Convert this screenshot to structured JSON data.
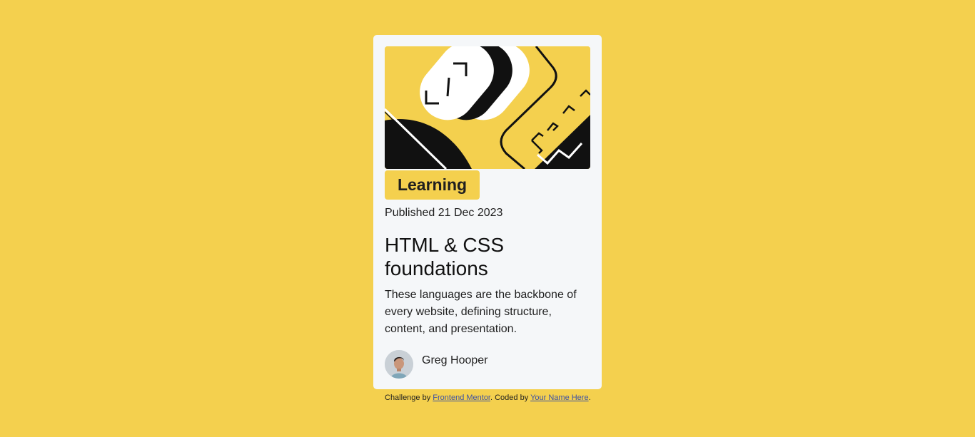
{
  "card": {
    "hero_image": "html-css-illustration",
    "tag": "Learning",
    "published": "Published 21 Dec 2023",
    "title": "HTML & CSS foundations",
    "description": "These languages are the backbone of every website, defining structure, content, and presentation.",
    "author": {
      "name": "Greg Hooper",
      "avatar": "avatar-photo"
    }
  },
  "attribution": {
    "prefix": "Challenge by ",
    "link1": "Frontend Mentor",
    "middle": ". Coded by ",
    "link2": "Your Name Here",
    "suffix": "."
  },
  "colors": {
    "background": "#f4d04e",
    "card": "#f5f7f9",
    "text": "#111111",
    "link": "#3e52a3"
  }
}
